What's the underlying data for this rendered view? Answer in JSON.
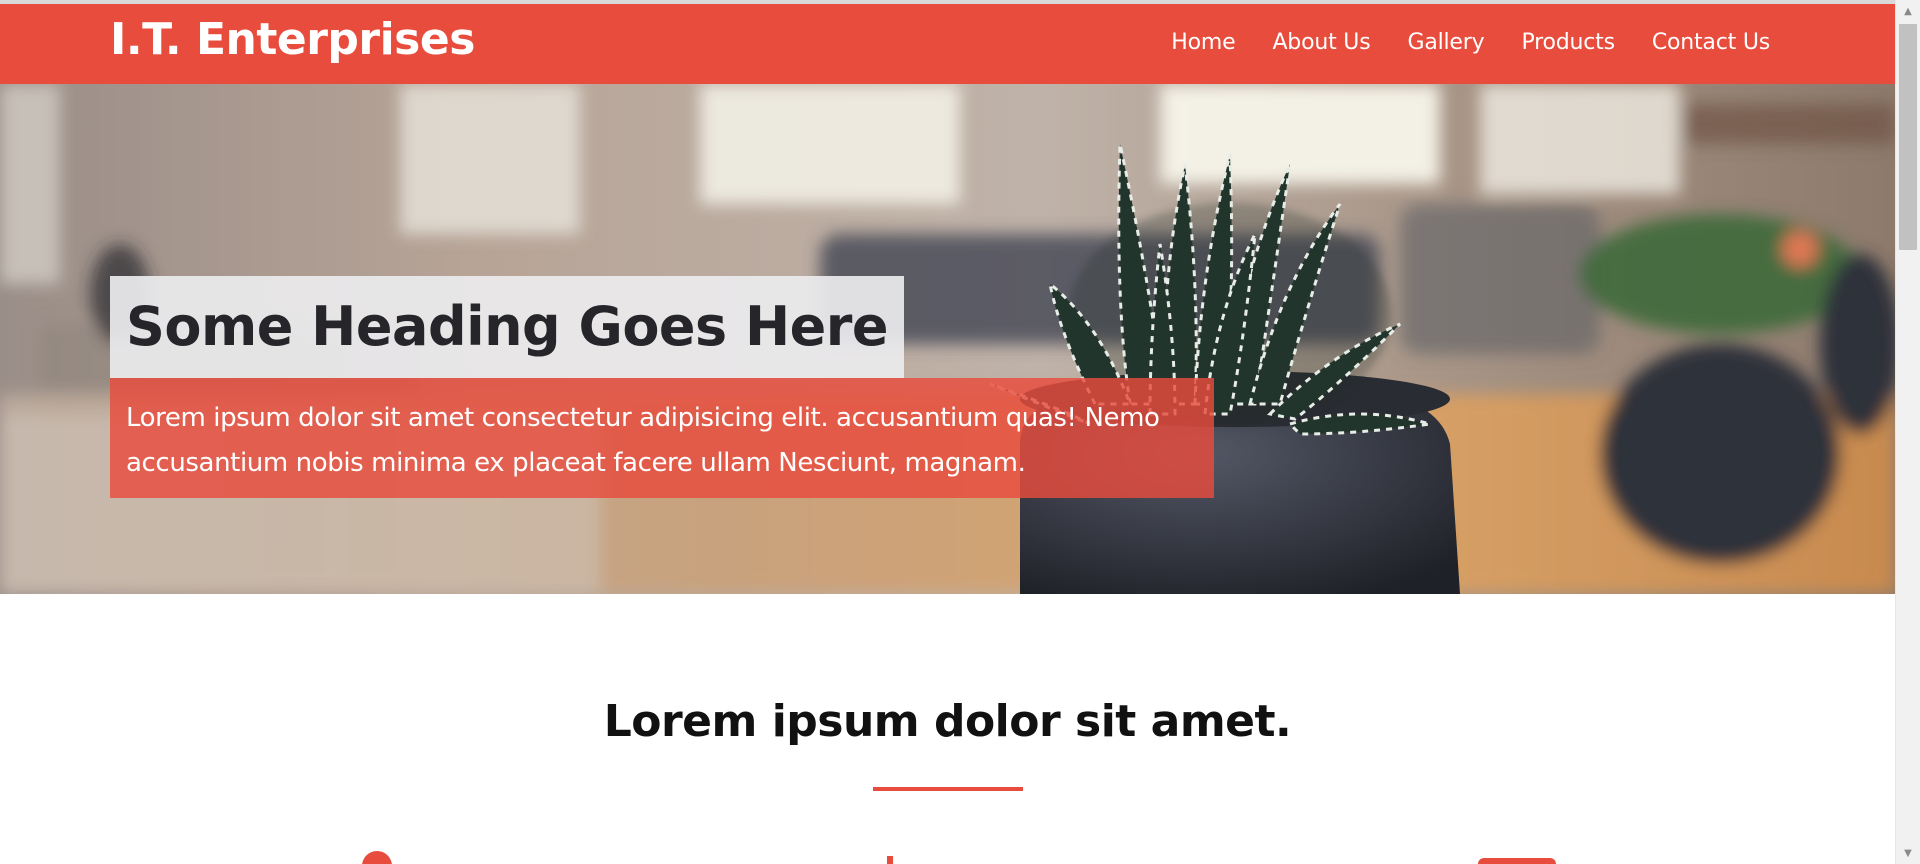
{
  "navbar": {
    "brand": "I.T. Enterprises",
    "links": [
      "Home",
      "About Us",
      "Gallery",
      "Products",
      "Contact Us"
    ],
    "background_color": "#e84c3d"
  },
  "hero": {
    "heading": "Some Heading Goes Here",
    "text": "Lorem ipsum dolor sit amet consectetur adipisicing elit. accusantium quas! Nemo accusantium nobis minima ex placeat facere ullam Nesciunt, magnam.",
    "image": "potted-succulent-plant-photo"
  },
  "section": {
    "title": "Lorem ipsum dolor sit amet.",
    "accent_color": "#e84c3d"
  },
  "scrollbar": {
    "up_icon": "triangle-up-icon",
    "down_icon": "triangle-down-icon"
  }
}
